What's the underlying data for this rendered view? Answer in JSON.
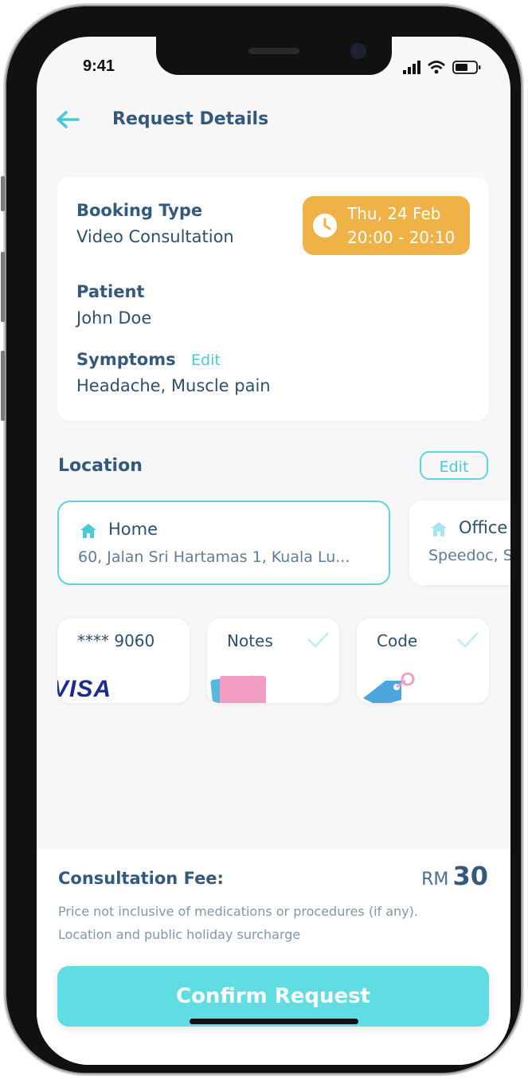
{
  "status_bar": {
    "time": "9:41"
  },
  "header": {
    "title": "Request Details",
    "back_icon": "arrow-left-icon"
  },
  "booking": {
    "type_label": "Booking Type",
    "type_value": "Video Consultation",
    "date": "Thu, 24 Feb",
    "time_range": "20:00 - 20:10",
    "badge_color": "#efb246",
    "patient_label": "Patient",
    "patient_value": "John Doe",
    "symptoms_label": "Symptoms",
    "symptoms_edit": "Edit",
    "symptoms_value": "Headache, Muscle pain"
  },
  "location": {
    "title": "Location",
    "edit_label": "Edit",
    "addresses": [
      {
        "name": "Home",
        "line": "60, Jalan Sri Hartamas 1, Kuala Lu...",
        "selected": true
      },
      {
        "name": "Office",
        "line": "Speedoc, S",
        "selected": false
      }
    ]
  },
  "extras": {
    "card": {
      "number": "**** 9060",
      "brand": "VISA"
    },
    "notes": {
      "label": "Notes"
    },
    "code": {
      "label": "Code"
    }
  },
  "fee": {
    "label": "Consultation Fee:",
    "currency": "RM",
    "amount": "30",
    "note_line1": "Price not inclusive of medications or procedures (if any).",
    "note_line2": "Location and public holiday surcharge"
  },
  "confirm_label": "Confirm Request",
  "colors": {
    "accent": "#5fdde3",
    "text_primary": "#34597c",
    "badge": "#efb246"
  }
}
